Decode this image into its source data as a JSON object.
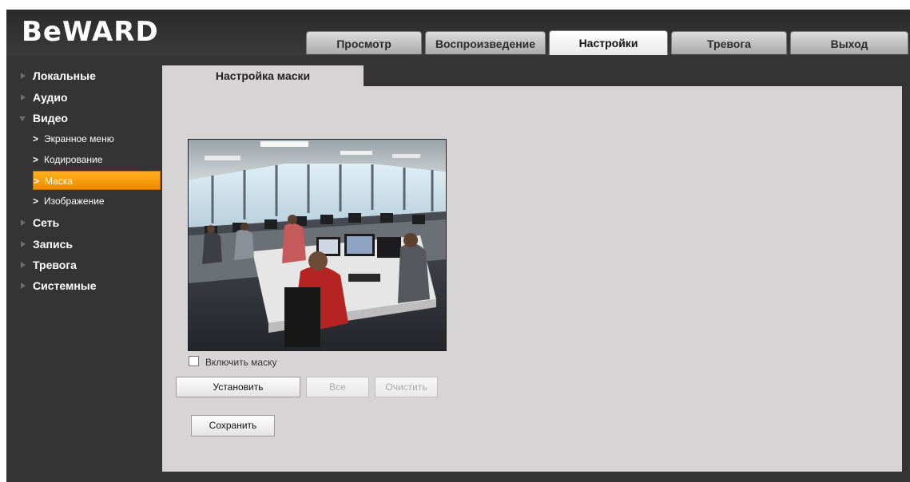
{
  "logo": {
    "text": "BeWARD"
  },
  "top_tabs": [
    {
      "label": "Просмотр",
      "active": false
    },
    {
      "label": "Воспроизведение",
      "active": false
    },
    {
      "label": "Настройки",
      "active": true
    },
    {
      "label": "Тревога",
      "active": false
    },
    {
      "label": "Выход",
      "active": false
    }
  ],
  "sidebar": {
    "sections": [
      {
        "label": "Локальные",
        "expanded": false
      },
      {
        "label": "Аудио",
        "expanded": false
      },
      {
        "label": "Видео",
        "expanded": true
      },
      {
        "label": "Сеть",
        "expanded": false
      },
      {
        "label": "Запись",
        "expanded": false
      },
      {
        "label": "Тревога",
        "expanded": false
      },
      {
        "label": "Системные",
        "expanded": false
      }
    ],
    "video_items": [
      {
        "label": "Экранное меню",
        "active": false
      },
      {
        "label": "Кодирование",
        "active": false
      },
      {
        "label": "Маска",
        "active": true
      },
      {
        "label": "Изображение",
        "active": false
      }
    ],
    "chevron": ">"
  },
  "content": {
    "tab_title": "Настройка маски",
    "enable_mask_label": "Включить маску",
    "enable_mask_checked": false,
    "set_button": "Установить",
    "all_button": "Все",
    "clear_button": "Очистить",
    "save_button": "Сохранить"
  },
  "colors": {
    "accent": "#f59a0c",
    "background": "#343434",
    "panel": "#d6d4d4"
  }
}
